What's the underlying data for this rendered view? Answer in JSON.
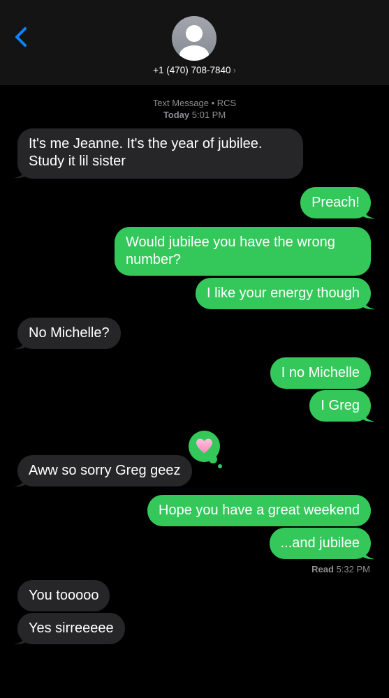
{
  "header": {
    "back_icon": "chevron-left-icon",
    "avatar_icon": "person-icon",
    "contact": "+1 (470) 708-7840",
    "contact_chevron": "›",
    "accent_color": "#0a84ff"
  },
  "conversation": {
    "service": "Text Message • RCS",
    "timestamp_prefix": "Today",
    "timestamp_time": "5:01 PM",
    "messages": [
      {
        "direction": "incoming",
        "text": "It's me Jeanne. It's the year of jubilee. Study it lil sister"
      },
      {
        "direction": "outgoing",
        "text": "Preach!"
      },
      {
        "direction": "outgoing",
        "text": "Would jubilee you have the wrong number?"
      },
      {
        "direction": "outgoing",
        "text": "I like your energy though"
      },
      {
        "direction": "incoming",
        "text": "No Michelle?"
      },
      {
        "direction": "outgoing",
        "text": "I no Michelle"
      },
      {
        "direction": "outgoing",
        "text": "I Greg"
      },
      {
        "direction": "incoming",
        "text": "Aww so sorry Greg geez",
        "tapback": "heart-icon"
      },
      {
        "direction": "outgoing",
        "text": "Hope you have a great weekend"
      },
      {
        "direction": "outgoing",
        "text": "...and jubilee"
      },
      {
        "direction": "incoming",
        "text": "You tooooo"
      },
      {
        "direction": "incoming",
        "text": "Yes sirreeeee"
      }
    ],
    "read_receipt": {
      "label": "Read",
      "time": "5:32 PM"
    }
  },
  "colors": {
    "outgoing_bubble": "#34c85a",
    "incoming_bubble": "#262628",
    "background": "#000000",
    "header_background": "#141414",
    "secondary_text": "#8e8e93"
  }
}
